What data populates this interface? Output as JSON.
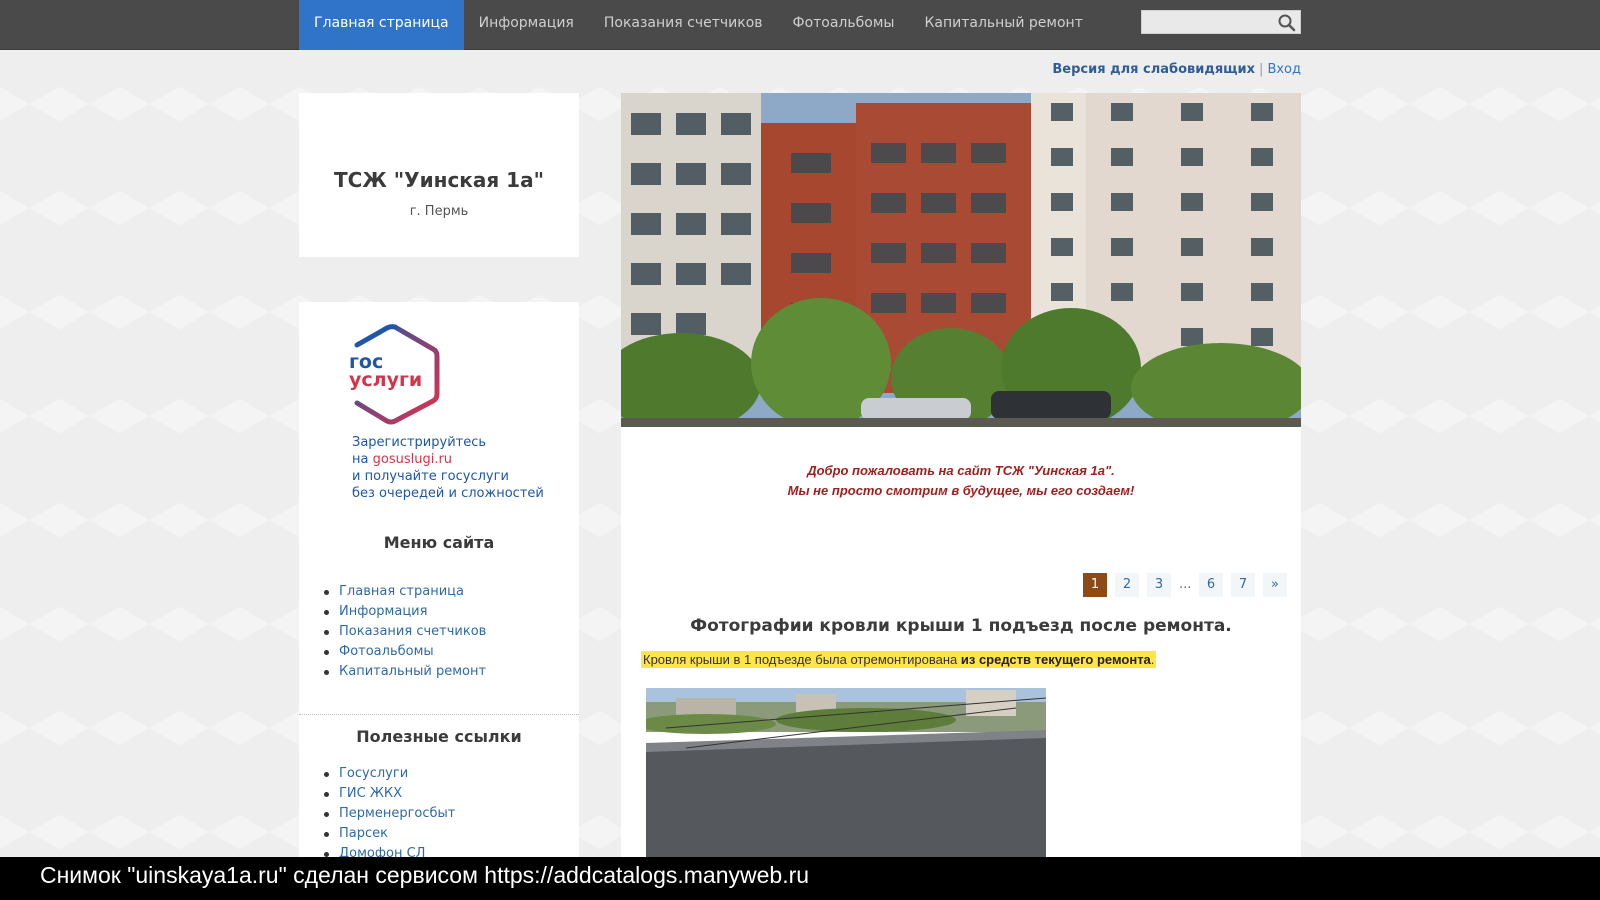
{
  "nav": {
    "items": [
      {
        "label": "Главная страница",
        "active": true
      },
      {
        "label": "Информация"
      },
      {
        "label": "Показания счетчиков"
      },
      {
        "label": "Фотоальбомы"
      },
      {
        "label": "Капитальный ремонт"
      }
    ],
    "search_value": ""
  },
  "access": {
    "low_vision": "Версия для слабовидящих",
    "separator": "|",
    "login": "Вход"
  },
  "brand": {
    "title": "ТСЖ \"Уинская 1а\"",
    "city": "г. Пермь"
  },
  "gosuslugi": {
    "logo_line1": "гос",
    "logo_line2": "услуги",
    "line1": "Зарегистрируйтесь",
    "line2_prefix": "на ",
    "line2_link": "gosuslugi.ru",
    "line3": "и получайте госуслуги",
    "line4": "без очередей и сложностей"
  },
  "site_menu": {
    "heading": "Меню сайта",
    "items": [
      "Главная страница",
      "Информация",
      "Показания счетчиков",
      "Фотоальбомы",
      "Капитальный ремонт"
    ]
  },
  "useful_links": {
    "heading": "Полезные ссылки",
    "items": [
      "Госуслуги",
      "ГИС ЖКХ",
      "Перменергосбыт",
      "Парсек",
      "Домофон СЛ"
    ]
  },
  "welcome": {
    "line1": "Добро пожаловать на сайт ТСЖ \"Уинская 1а\".",
    "line2": "Мы не просто смотрим в будущее, мы его создаем!"
  },
  "pager": {
    "pages": [
      "1",
      "2",
      "3",
      "...",
      "6",
      "7",
      "»"
    ],
    "current": "1"
  },
  "post": {
    "title": "Фотографии кровли крыши 1 подъезд после ремонта.",
    "text": "Кровля крыши в 1 подъезде была отремонтирована ",
    "text_bold": "из средств текущего ремонта",
    "text_end": "."
  },
  "caption": "Снимок \"uinskaya1a.ru\" сделан сервисом https://addcatalogs.manyweb.ru",
  "colors": {
    "nav_bg": "#4a4a4a",
    "nav_active": "#2f74c9",
    "welcome_text": "#a31e1e",
    "highlight": "#ffe44a",
    "pager_active": "#8b4a18"
  }
}
